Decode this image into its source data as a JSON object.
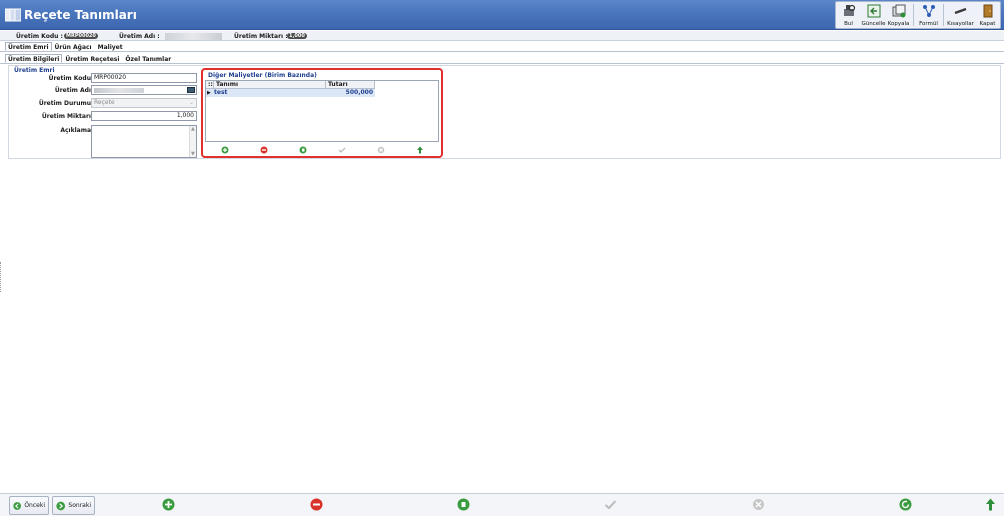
{
  "window": {
    "title": "Reçete Tanımları"
  },
  "toolbar": {
    "buttons": [
      {
        "label": "Bul",
        "icon": "find-icon"
      },
      {
        "label": "Güncelle",
        "icon": "update-icon"
      },
      {
        "label": "Kopyala",
        "icon": "copy-icon"
      },
      {
        "label": "Formül",
        "icon": "formula-icon"
      },
      {
        "label": "Kısayollar",
        "icon": "shortcuts-icon"
      },
      {
        "label": "Kapat",
        "icon": "close-door-icon"
      }
    ]
  },
  "info": {
    "code_label": "Üretim Kodu  :",
    "code_value": "MRP00020",
    "name_label": "Üretim Adı  :",
    "qty_label": "Üretim Miktarı  :",
    "qty_value": "1,000"
  },
  "main_tabs": [
    "Üretim Emri",
    "Ürün Ağacı",
    "Maliyet"
  ],
  "sub_tabs": [
    "Üretim Bilgileri",
    "Üretim Reçetesi",
    "Özel Tanımlar"
  ],
  "form": {
    "group_title": "Üretim Emri",
    "code_label": "Üretim Kodu",
    "code_value": "MRP00020",
    "name_label": "Üretim Adı",
    "status_label": "Üretim Durumu",
    "status_value": "Reçete",
    "qty_label": "Üretim Miktarı",
    "qty_value": "1,000",
    "desc_label": "Açıklama"
  },
  "costs": {
    "title": "Diğer Maliyetler (Birim Bazında)",
    "columns": [
      "Tanımı",
      "Tutarı"
    ],
    "rows": [
      {
        "name": "test",
        "amount": "500,000"
      }
    ]
  },
  "bottom": {
    "prev_label": "Önceki",
    "next_label": "Sonraki"
  },
  "colors": {
    "accent_red": "#e0312f",
    "title_blue": "#4a76be",
    "link_blue": "#1f3f8f"
  }
}
